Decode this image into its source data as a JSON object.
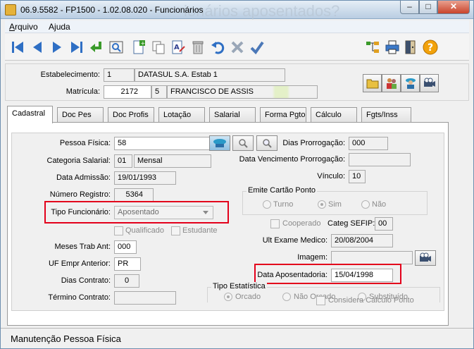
{
  "window": {
    "title": "06.9.5582 - FP1500 - 1.02.08.020 - Funcionários",
    "watermark": "ionários aposentados?",
    "min_label": "–",
    "max_label": "□",
    "close_label": "✕"
  },
  "menu": {
    "items": [
      {
        "label_u": "A",
        "label_rest": "rquivo"
      },
      {
        "label_u": "A",
        "label_rest": "juda"
      }
    ]
  },
  "toolbar": {
    "icons": [
      "first-icon",
      "prev-icon",
      "next-icon",
      "last-icon",
      "goto-icon",
      "search-icon",
      "add-icon",
      "copy-icon",
      "edit-icon",
      "delete-icon",
      "undo-icon",
      "cancel-icon",
      "save-icon",
      "tree-icon",
      "print-icon",
      "exit-icon",
      "help-icon"
    ]
  },
  "header": {
    "estabelecimento_label": "Estabelecimento:",
    "estabelecimento_code": "1",
    "estabelecimento_name": "DATASUL S.A. Estab 1",
    "matricula_label": "Matrícula:",
    "matricula_value": "2172",
    "matricula_digit": "5",
    "matricula_name": "FRANCISCO DE ASSIS"
  },
  "tabs": [
    "Cadastral",
    "Doc Pes",
    "Doc Profis",
    "Lotação",
    "Salarial",
    "Forma Pgto",
    "Cálculo",
    "Fgts/Inss"
  ],
  "form": {
    "pessoa_fisica_label": "Pessoa Física:",
    "pessoa_fisica_value": "58",
    "categoria_label": "Categoria Salarial:",
    "categoria_code": "01",
    "categoria_name": "Mensal",
    "data_admissao_label": "Data Admissão:",
    "data_admissao_value": "19/01/1993",
    "numero_registro_label": "Número Registro:",
    "numero_registro_value": "5364",
    "tipo_funcionario_label": "Tipo Funcionário:",
    "tipo_funcionario_value": "Aposentado",
    "qualificado_label": "Qualificado",
    "estudante_label": "Estudante",
    "meses_trab_label": "Meses Trab Ant:",
    "meses_trab_value": "000",
    "uf_empr_label": "UF Empr Anterior:",
    "uf_empr_value": "PR",
    "dias_contrato_label": "Dias Contrato:",
    "dias_contrato_value": "0",
    "termino_contrato_label": "Término Contrato:",
    "termino_contrato_value": "",
    "dias_prorrogacao_label": "Dias Prorrogação:",
    "dias_prorrogacao_value": "000",
    "data_venc_prorrog_label": "Data Vencimento Prorrogação:",
    "data_venc_prorrog_value": "",
    "vinculo_label": "Vínculo:",
    "vinculo_value": "10",
    "emite_cartao_title": "Emite Cartão Ponto",
    "emite_cartao_options": [
      "Turno",
      "Sim",
      "Não"
    ],
    "cooperado_label": "Cooperado",
    "categ_sefip_label": "Categ SEFIP:",
    "categ_sefip_value": "00",
    "ult_exame_label": "Ult Exame Medico:",
    "ult_exame_value": "20/08/2004",
    "imagem_label": "Imagem:",
    "imagem_value": "",
    "data_aposentadoria_label": "Data Aposentadoria:",
    "data_aposentadoria_value": "15/04/1998",
    "tipo_estatistica_title": "Tipo Estatística",
    "tipo_estatistica_options": [
      "Orcado",
      "Não Orcado",
      "Substituído"
    ],
    "considera_calculo_label": "Considera Cálculo Ponto"
  },
  "status": {
    "text": "Manutenção Pessoa Física"
  },
  "colors": {
    "highlight_border": "#e3001b",
    "toolbar_blue": "#2f6fc4"
  }
}
